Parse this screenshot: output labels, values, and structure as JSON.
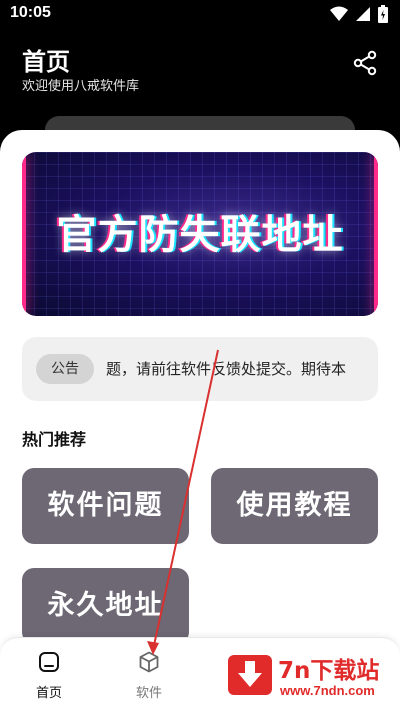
{
  "status_bar": {
    "time": "10:05",
    "icons": [
      "wifi-icon",
      "signal-icon",
      "battery-icon"
    ]
  },
  "header": {
    "title": "首页",
    "subtitle": "欢迎使用八戒软件库",
    "share_icon": "share-icon"
  },
  "banner": {
    "text": "官方防失联地址"
  },
  "notice": {
    "tag": "公告",
    "text": "题，请前往软件反馈处提交。期待本"
  },
  "section": {
    "title": "热门推荐"
  },
  "tiles": [
    {
      "label": "软件问题"
    },
    {
      "label": "使用教程"
    },
    {
      "label": "永久地址"
    }
  ],
  "bottom_nav": {
    "items": [
      {
        "label": "首页",
        "icon": "home-icon",
        "active": true
      },
      {
        "label": "软件",
        "icon": "cube-icon",
        "active": false
      }
    ]
  },
  "watermark": {
    "title": "7n下载站",
    "url": "www.7ndn.com"
  },
  "colors": {
    "tile_bg": "#6d6873",
    "accent_red": "#e12b2b",
    "background": "#000000"
  }
}
